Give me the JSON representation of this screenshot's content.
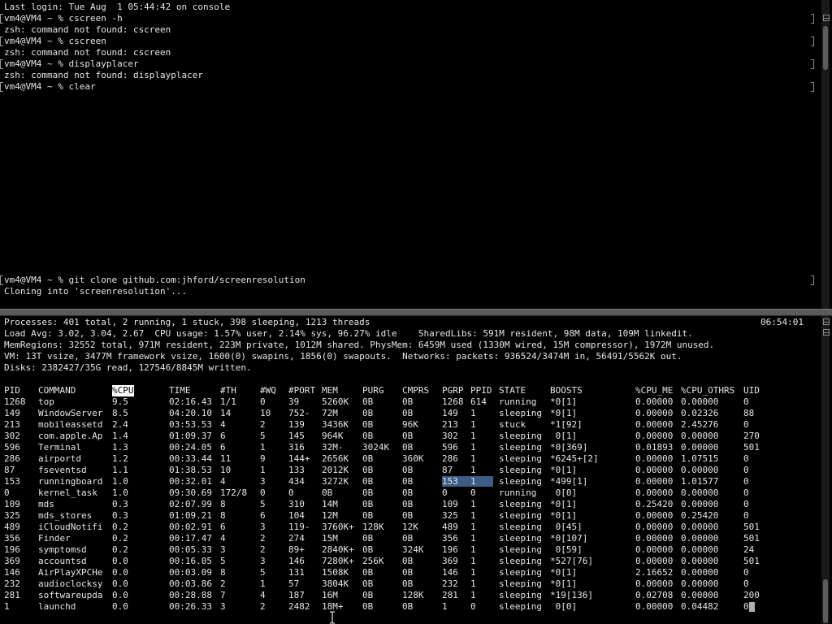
{
  "top_pane": {
    "lines": [
      {
        "text": "Last login: Tue Aug  1 05:44:42 on console",
        "prompt": false
      },
      {
        "text": "vm4@VM4 ~ % cscreen -h",
        "prompt": true
      },
      {
        "text": "zsh: command not found: cscreen",
        "prompt": false
      },
      {
        "text": "vm4@VM4 ~ % cscreen",
        "prompt": true
      },
      {
        "text": "zsh: command not found: cscreen",
        "prompt": false
      },
      {
        "text": "vm4@VM4 ~ % displayplacer",
        "prompt": true
      },
      {
        "text": "zsh: command not found: displayplacer",
        "prompt": false
      },
      {
        "text": "vm4@VM4 ~ % clear",
        "prompt": true
      }
    ],
    "lines_after_clear": [
      {
        "text": "vm4@VM4 ~ % git clone github.com:jhford/screenresolution",
        "prompt": true
      },
      {
        "text": "Cloning into 'screenresolution'...",
        "prompt": false
      }
    ]
  },
  "top_summary": {
    "time": "06:54:01",
    "lines": [
      "Processes: 401 total, 2 running, 1 stuck, 398 sleeping, 1213 threads",
      "Load Avg: 3.02, 3.04, 2.67  CPU usage: 1.57% user, 2.14% sys, 96.27% idle    SharedLibs: 591M resident, 98M data, 109M linkedit.",
      "MemRegions: 32552 total, 971M resident, 223M private, 1012M shared. PhysMem: 6459M used (1330M wired, 15M compressor), 1972M unused.",
      "VM: 13T vsize, 3477M framework vsize, 1600(0) swapins, 1856(0) swapouts.  Networks: packets: 936524/3474M in, 56491/5562K out.",
      "Disks: 2382427/35G read, 127546/8845M written."
    ]
  },
  "process_table": {
    "columns": [
      "PID",
      "COMMAND",
      "%CPU",
      "TIME",
      "#TH",
      "#WQ",
      "#PORT",
      "MEM",
      "PURG",
      "CMPRS",
      "PGRP",
      "PPID",
      "STATE",
      "BOOSTS",
      "%CPU_ME",
      "%CPU_OTHRS",
      "UID"
    ],
    "sorted_column": "%CPU",
    "rows": [
      [
        "1268",
        "top",
        "9.5",
        "02:16.43",
        "1/1",
        "0",
        "39",
        "5260K",
        "0B",
        "0B",
        "1268",
        "614",
        "running",
        "*0[1]",
        "0.00000",
        "0.00000",
        "0"
      ],
      [
        "149",
        "WindowServer",
        "8.5",
        "04:20.10",
        "14",
        "10",
        "752-",
        "72M",
        "0B",
        "0B",
        "149",
        "1",
        "sleeping",
        "*0[1]",
        "0.00000",
        "0.02326",
        "88"
      ],
      [
        "213",
        "mobileassetd",
        "2.4",
        "03:53.53",
        "4",
        "2",
        "139",
        "3436K",
        "0B",
        "96K",
        "213",
        "1",
        "stuck",
        "*1[92]",
        "0.00000",
        "2.45276",
        "0"
      ],
      [
        "302",
        "com.apple.Ap",
        "1.4",
        "01:09.37",
        "6",
        "5",
        "145",
        "964K",
        "0B",
        "0B",
        "302",
        "1",
        "sleeping",
        " 0[1]",
        "0.00000",
        "0.00000",
        "270"
      ],
      [
        "596",
        "Terminal",
        "1.3",
        "00:24.05",
        "6",
        "1",
        "316",
        "32M-",
        "3024K",
        "0B",
        "596",
        "1",
        "sleeping",
        "*0[369]",
        "0.01893",
        "0.00000",
        "501"
      ],
      [
        "286",
        "airportd",
        "1.2",
        "00:33.44",
        "11",
        "9",
        "144+",
        "2656K",
        "0B",
        "360K",
        "286",
        "1",
        "sleeping",
        "*6245+[2]",
        "0.00000",
        "1.07515",
        "0"
      ],
      [
        "87",
        "fseventsd",
        "1.1",
        "01:38.53",
        "10",
        "1",
        "133",
        "2012K",
        "0B",
        "0B",
        "87",
        "1",
        "sleeping",
        "*0[1]",
        "0.00000",
        "0.00000",
        "0"
      ],
      [
        "153",
        "runningboard",
        "1.0",
        "00:32.01",
        "4",
        "3",
        "434",
        "3272K",
        "0B",
        "0B",
        "153",
        "1",
        "sleeping",
        "*499[1]",
        "0.00000",
        "1.01577",
        "0"
      ],
      [
        "0",
        "kernel_task",
        "1.0",
        "09:30.69",
        "172/8",
        "0",
        "0",
        "0B",
        "0B",
        "0B",
        "0",
        "0",
        "running",
        " 0[0]",
        "0.00000",
        "0.00000",
        "0"
      ],
      [
        "109",
        "mds",
        "0.3",
        "02:07.99",
        "8",
        "5",
        "310",
        "14M",
        "0B",
        "0B",
        "109",
        "1",
        "sleeping",
        "*0[1]",
        "0.25420",
        "0.00000",
        "0"
      ],
      [
        "325",
        "mds_stores",
        "0.3",
        "01:09.21",
        "8",
        "6",
        "104",
        "12M",
        "0B",
        "0B",
        "325",
        "1",
        "sleeping",
        "*0[1]",
        "0.00000",
        "0.25420",
        "0"
      ],
      [
        "489",
        "iCloudNotifi",
        "0.2",
        "00:02.91",
        "6",
        "3",
        "119-",
        "3760K+",
        "128K",
        "12K",
        "489",
        "1",
        "sleeping",
        " 0[45]",
        "0.00000",
        "0.00000",
        "501"
      ],
      [
        "356",
        "Finder",
        "0.2",
        "00:17.47",
        "4",
        "2",
        "274",
        "15M",
        "0B",
        "0B",
        "356",
        "1",
        "sleeping",
        "*0[107]",
        "0.00000",
        "0.00000",
        "501"
      ],
      [
        "196",
        "symptomsd",
        "0.2",
        "00:05.33",
        "3",
        "2",
        "89+",
        "2840K+",
        "0B",
        "324K",
        "196",
        "1",
        "sleeping",
        " 0[59]",
        "0.00000",
        "0.00000",
        "24"
      ],
      [
        "369",
        "accountsd",
        "0.0",
        "00:16.05",
        "5",
        "3",
        "146",
        "7280K+",
        "256K",
        "0B",
        "369",
        "1",
        "sleeping",
        "*527[76]",
        "0.00000",
        "0.00000",
        "501"
      ],
      [
        "146",
        "AirPlayXPCHe",
        "0.0",
        "00:03.09",
        "8",
        "5",
        "131",
        "1508K",
        "0B",
        "0B",
        "146",
        "1",
        "sleeping",
        "*0[1]",
        "2.16652",
        "0.00000",
        "0"
      ],
      [
        "232",
        "audioclocksy",
        "0.0",
        "00:03.86",
        "2",
        "1",
        "57",
        "3804K",
        "0B",
        "0B",
        "232",
        "1",
        "sleeping",
        "*0[1]",
        "0.00000",
        "0.00000",
        "0"
      ],
      [
        "281",
        "softwareupda",
        "0.0",
        "00:28.88",
        "7",
        "4",
        "187",
        "16M",
        "0B",
        "128K",
        "281",
        "1",
        "sleeping",
        "*19[136]",
        "0.02708",
        "0.00000",
        "200"
      ],
      [
        "1",
        "launchd",
        "0.0",
        "00:26.33",
        "3",
        "2",
        "2482",
        "18M+",
        "0B",
        "0B",
        "1",
        "0",
        "sleeping",
        " 0[0]",
        "0.00000",
        "0.04482",
        "0"
      ]
    ]
  },
  "colors": {
    "background": "#000000",
    "text": "#e6e6e6",
    "selection": "#3e5d86",
    "divider": "#5a5a5a"
  }
}
